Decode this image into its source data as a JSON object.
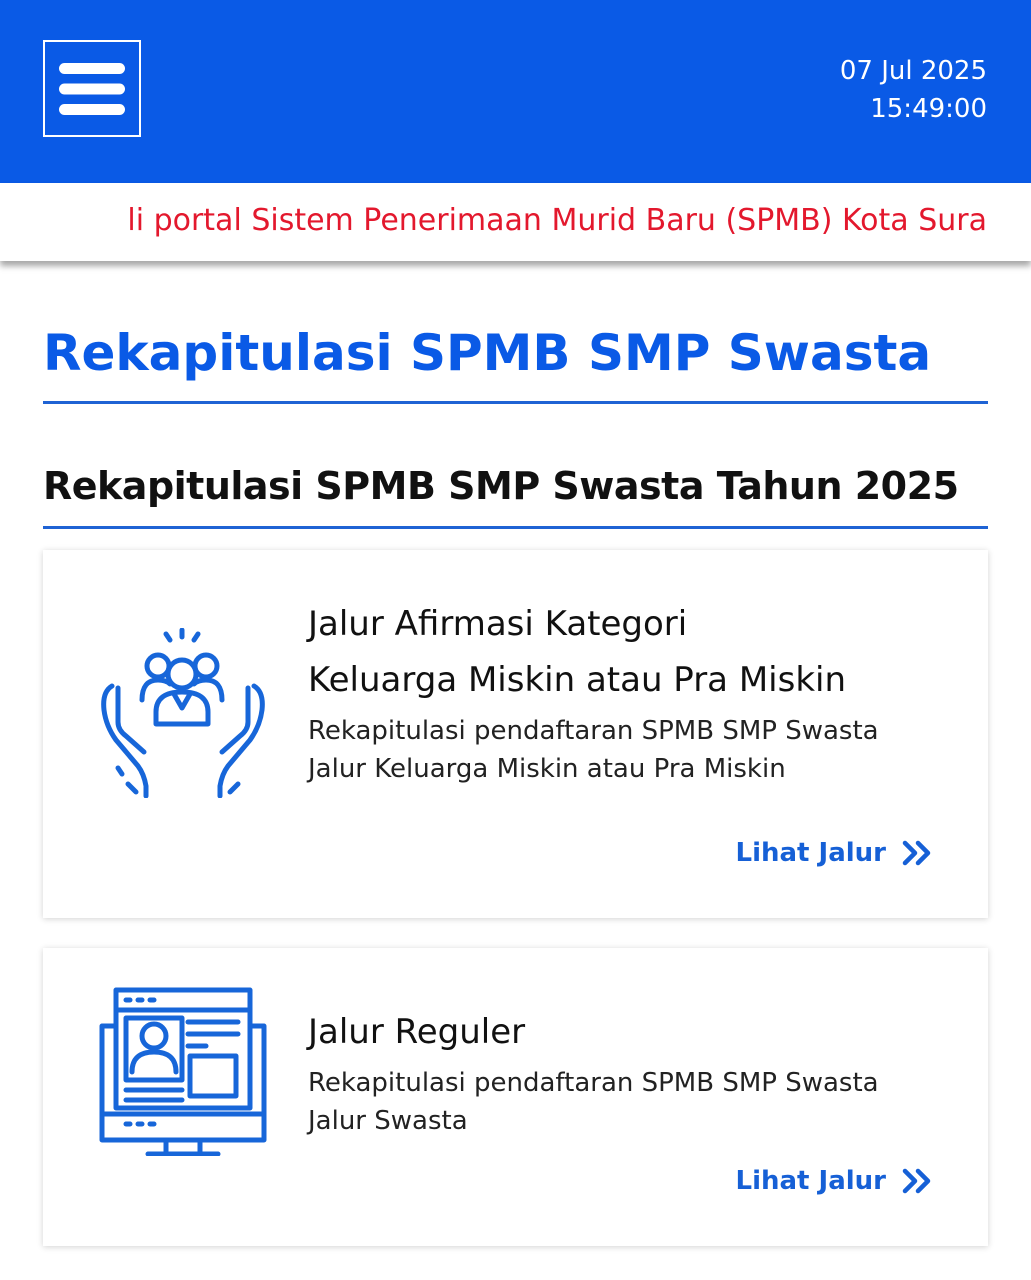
{
  "header": {
    "date": "07 Jul 2025",
    "time": "15:49:00",
    "menu_icon": "hamburger-menu-icon",
    "background_color": "#0a5ae6"
  },
  "ticker": {
    "text": "li portal Sistem Penerimaan Murid Baru (SPMB) Kota Sura",
    "color": "#e3182d"
  },
  "main": {
    "page_title": "Rekapitulasi SPMB SMP Swasta",
    "section_title": "Rekapitulasi SPMB SMP Swasta Tahun 2025",
    "cards": [
      {
        "icon": "hands-people-icon",
        "title_line1": "Jalur Afirmasi Kategori",
        "title_line2": "Keluarga Miskin atau Pra Miskin",
        "description": "Rekapitulasi pendaftaran SPMB SMP Swasta Jalur Keluarga Miskin atau Pra Miskin",
        "link_label": "Lihat Jalur"
      },
      {
        "icon": "computer-profile-icon",
        "title": "Jalur Reguler",
        "description": "Rekapitulasi pendaftaran SPMB SMP Swasta Jalur Swasta",
        "link_label": "Lihat Jalur"
      }
    ]
  },
  "colors": {
    "accent": "#0a5ae6",
    "link": "#1660d6",
    "ticker": "#e3182d"
  }
}
